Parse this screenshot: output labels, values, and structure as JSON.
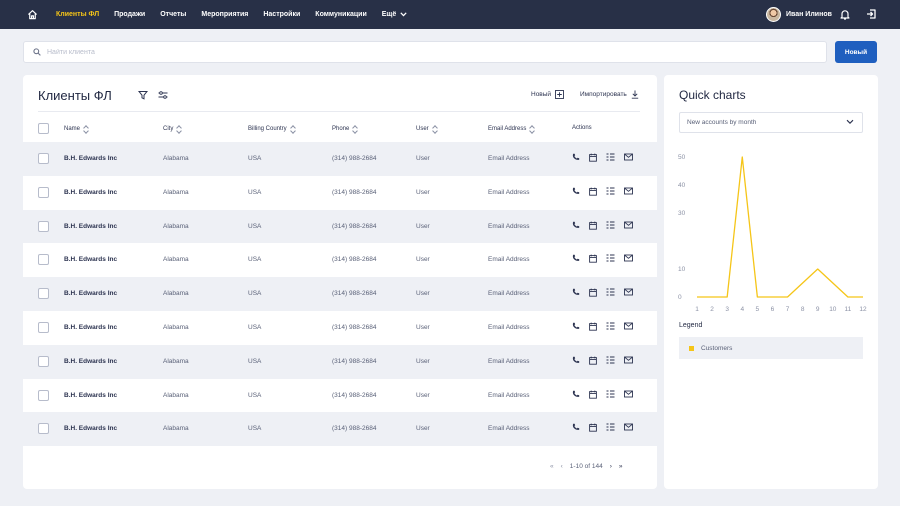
{
  "nav": {
    "items": [
      "Клиенты ФЛ",
      "Продажи",
      "Отчеты",
      "Мероприятия",
      "Настройки",
      "Коммуникации"
    ],
    "active_index": 0,
    "more_label": "Ещё",
    "user_name": "Иван Илинов"
  },
  "search": {
    "placeholder": "Найти клиента",
    "value": ""
  },
  "toolbar": {
    "new_label": "Новый"
  },
  "table": {
    "title": "Клиенты ФЛ",
    "new_label": "Новый",
    "import_label": "Импортировать",
    "columns": [
      "Name",
      "City",
      "Billing Country",
      "Phone",
      "User",
      "Email Address",
      "Actions"
    ],
    "rows": [
      [
        "B.H. Edwards Inc",
        "Alabama",
        "USA",
        "(314) 988-2684",
        "User",
        "Email Address"
      ],
      [
        "B.H. Edwards Inc",
        "Alabama",
        "USA",
        "(314) 988-2684",
        "User",
        "Email Address"
      ],
      [
        "B.H. Edwards Inc",
        "Alabama",
        "USA",
        "(314) 988-2684",
        "User",
        "Email Address"
      ],
      [
        "B.H. Edwards Inc",
        "Alabama",
        "USA",
        "(314) 988-2684",
        "User",
        "Email Address"
      ],
      [
        "B.H. Edwards Inc",
        "Alabama",
        "USA",
        "(314) 988-2684",
        "User",
        "Email Address"
      ],
      [
        "B.H. Edwards Inc",
        "Alabama",
        "USA",
        "(314) 988-2684",
        "User",
        "Email Address"
      ],
      [
        "B.H. Edwards Inc",
        "Alabama",
        "USA",
        "(314) 988-2684",
        "User",
        "Email Address"
      ],
      [
        "B.H. Edwards Inc",
        "Alabama",
        "USA",
        "(314) 988-2684",
        "User",
        "Email Address"
      ],
      [
        "B.H. Edwards Inc",
        "Alabama",
        "USA",
        "(314) 988-2684",
        "User",
        "Email Address"
      ]
    ],
    "row_action_icons": [
      "phone-icon",
      "calendar-icon",
      "task-list-icon",
      "mail-icon"
    ],
    "pagination": "1-10 of 144"
  },
  "quick_charts": {
    "title": "Quick charts",
    "select_value": "New accounts by month",
    "legend_title": "Legend",
    "legend_items": [
      "Customers"
    ]
  },
  "colors": {
    "nav_bg": "#283047",
    "nav_active": "#f5c518",
    "primary": "#1f5fbf",
    "series": "#f5c518"
  },
  "chart_data": {
    "type": "line",
    "x": [
      1,
      2,
      3,
      4,
      5,
      6,
      7,
      8,
      9,
      10,
      11,
      12
    ],
    "series": [
      {
        "name": "Customers",
        "values": [
          0,
          0,
          0,
          50,
          0,
          0,
          0,
          5,
          10,
          5,
          0,
          0
        ]
      }
    ],
    "yticks": [
      0,
      10,
      30,
      40,
      50
    ],
    "ylim": [
      0,
      50
    ],
    "grid": false,
    "legend": "bottom"
  }
}
